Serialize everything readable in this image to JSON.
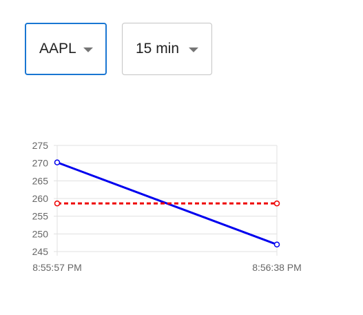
{
  "controls": {
    "symbol": {
      "value": "AAPL"
    },
    "range": {
      "value": "15 min"
    }
  },
  "colors": {
    "series_a": "#0000ee",
    "series_b": "#ee0000",
    "grid": "#e0e0e0",
    "tick_text": "#666666",
    "select_focus_border": "#1976d2"
  },
  "icons": {
    "dropdown": "caret-down-icon"
  },
  "chart_data": {
    "type": "line",
    "title": "",
    "xlabel": "",
    "ylabel": "",
    "x": [
      "8:55:57 PM",
      "8:56:38 PM"
    ],
    "ylim": [
      245,
      275
    ],
    "yticks": [
      275,
      270,
      265,
      260,
      255,
      250,
      245
    ],
    "grid": true,
    "series": [
      {
        "values": [
          270.2,
          247.0
        ],
        "style": "solid",
        "color": "#0000ee"
      },
      {
        "values": [
          258.6,
          258.6
        ],
        "style": "dashed",
        "color": "#ee0000"
      }
    ]
  }
}
